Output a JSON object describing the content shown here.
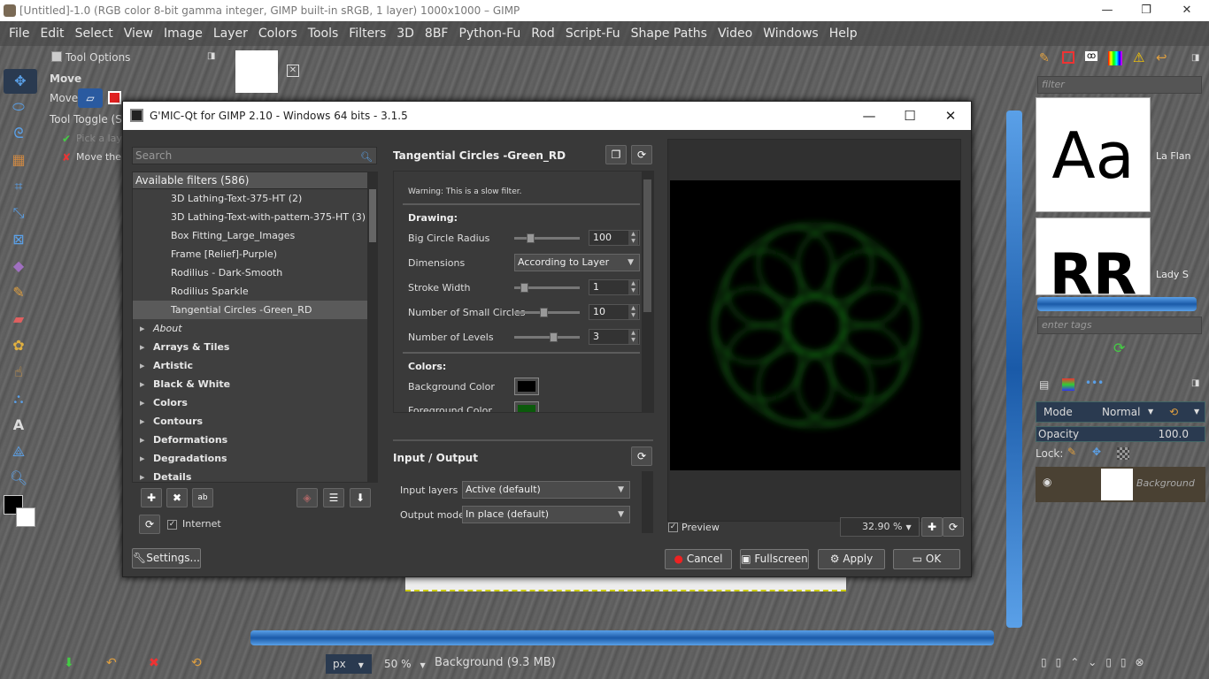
{
  "window": {
    "title": "[Untitled]-1.0 (RGB color 8-bit gamma integer, GIMP built-in sRGB, 1 layer) 1000x1000 – GIMP",
    "minimize": "—",
    "maximize": "❐",
    "close": "✕"
  },
  "menubar": [
    "File",
    "Edit",
    "Select",
    "View",
    "Image",
    "Layer",
    "Colors",
    "Tools",
    "Filters",
    "3D",
    "8BF",
    "Python-Fu",
    "Rod",
    "Script-Fu",
    "Shape Paths",
    "Video",
    "Windows",
    "Help"
  ],
  "tool_options": {
    "title": "Tool Options",
    "tool_name": "Move",
    "move_label": "Move:",
    "tool_toggle": "Tool Toggle (Sh",
    "pick_layer": "Pick a laye",
    "move_the": "Move the"
  },
  "gmic": {
    "title": "G'MIC-Qt for GIMP 2.10 - Windows 64 bits - 3.1.5",
    "search_placeholder": "Search",
    "filters_header": "Available filters (586)",
    "filters": [
      {
        "label": "3D Lathing-Text-375-HT (2)",
        "kind": "item"
      },
      {
        "label": "3D Lathing-Text-with-pattern-375-HT (3)",
        "kind": "item"
      },
      {
        "label": "Box Fitting_Large_Images",
        "kind": "item"
      },
      {
        "label": "Frame [Relief]-Purple)",
        "kind": "item"
      },
      {
        "label": "Rodilius - Dark-Smooth",
        "kind": "item"
      },
      {
        "label": "Rodilius Sparkle",
        "kind": "item"
      },
      {
        "label": "Tangential Circles -Green_RD",
        "kind": "selected"
      },
      {
        "label": "About",
        "kind": "about"
      },
      {
        "label": "Arrays & Tiles",
        "kind": "cat"
      },
      {
        "label": "Artistic",
        "kind": "cat"
      },
      {
        "label": "Black & White",
        "kind": "cat"
      },
      {
        "label": "Colors",
        "kind": "cat"
      },
      {
        "label": "Contours",
        "kind": "cat"
      },
      {
        "label": "Deformations",
        "kind": "cat"
      },
      {
        "label": "Degradations",
        "kind": "cat"
      },
      {
        "label": "Details",
        "kind": "cat"
      }
    ],
    "internet_label": "Internet",
    "settings_label": "Settings...",
    "filter_name": "Tangential Circles -Green_RD",
    "warning": "Warning: This is a slow filter.",
    "drawing_header": "Drawing:",
    "params": {
      "big_circle_radius": {
        "label": "Big Circle Radius",
        "value": "100",
        "fraction": 0.22
      },
      "dimensions": {
        "label": "Dimensions",
        "value": "According to Layer"
      },
      "stroke_width": {
        "label": "Stroke Width",
        "value": "1",
        "fraction": 0.1
      },
      "small_circles": {
        "label": "Number of Small Circles",
        "value": "10",
        "fraction": 0.45
      },
      "levels": {
        "label": "Number of Levels",
        "value": "3",
        "fraction": 0.62
      }
    },
    "colors_header": "Colors:",
    "background_color": {
      "label": "Background Color",
      "color": "#000000"
    },
    "foreground_color": {
      "label": "Foreground Color",
      "color": "#0b5a0b"
    },
    "io_title": "Input / Output",
    "input_layers_label": "Input layers",
    "input_layers_value": "Active (default)",
    "output_mode_label": "Output mode",
    "output_mode_value": "In place (default)",
    "preview_label": "Preview",
    "zoom": "32.90 %",
    "buttons": {
      "cancel": "Cancel",
      "fullscreen": "Fullscreen",
      "apply": "Apply",
      "ok": "OK"
    }
  },
  "right_panel": {
    "filter_placeholder": "filter",
    "fonts": [
      {
        "preview": "Aa",
        "name": "La Flan"
      },
      {
        "preview": "RR",
        "name": "Lady S"
      }
    ],
    "tags_placeholder": "enter tags",
    "mode_label": "Mode",
    "mode_value": "Normal",
    "opacity_label": "Opacity",
    "opacity_value": "100.0",
    "lock_label": "Lock:",
    "layer_name": "Background"
  },
  "statusbar": {
    "unit": "px",
    "zoom": "50 %",
    "layer_info": "Background (9.3 MB)"
  },
  "colors": {
    "accent": "#5aa0e8",
    "dialog_bg": "#393939"
  }
}
